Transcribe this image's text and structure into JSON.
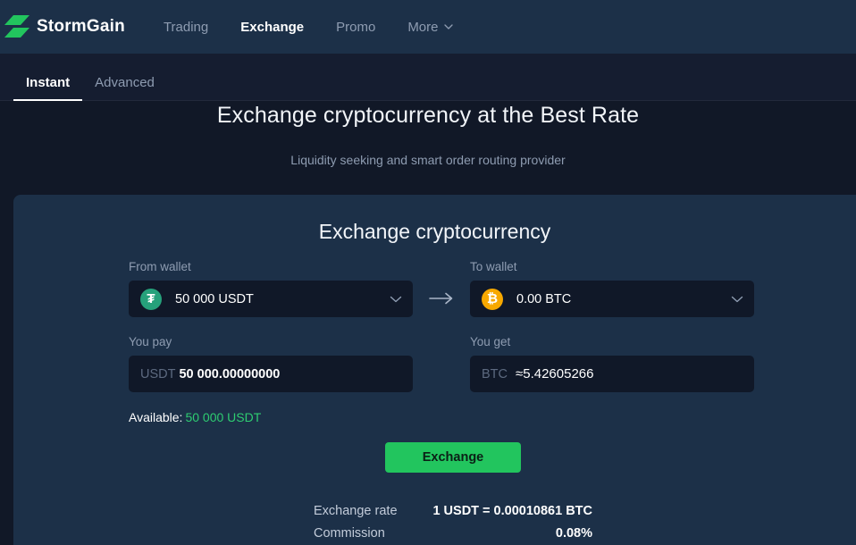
{
  "header": {
    "brand": "StormGain",
    "logo_icon": "stormgain-lightning-logo",
    "accent_green": "#22c55e",
    "nav": [
      {
        "label": "Trading",
        "active": false,
        "has_chevron": false
      },
      {
        "label": "Exchange",
        "active": true,
        "has_chevron": false
      },
      {
        "label": "Promo",
        "active": false,
        "has_chevron": false
      },
      {
        "label": "More",
        "active": false,
        "has_chevron": true
      }
    ]
  },
  "tabs": [
    {
      "label": "Instant",
      "active": true
    },
    {
      "label": "Advanced",
      "active": false
    }
  ],
  "hero": {
    "title": "Exchange cryptocurrency at the Best Rate",
    "subtitle": "Liquidity seeking and smart order routing provider"
  },
  "card": {
    "title": "Exchange cryptocurrency",
    "from": {
      "label": "From wallet",
      "coin_icon": "usdt-tether-icon",
      "coin_symbol": "₮",
      "coin_color": "#26a17b",
      "value": "50 000 USDT",
      "chevron_icon": "chevron-down-icon"
    },
    "to": {
      "label": "To wallet",
      "coin_icon": "bitcoin-icon",
      "coin_symbol": "₿",
      "coin_color": "#f7a800",
      "value": "0.00 BTC",
      "chevron_icon": "chevron-down-icon"
    },
    "arrow_icon": "arrow-right-icon",
    "you_pay": {
      "label": "You pay",
      "currency": "USDT",
      "value": "50 000.00000000"
    },
    "you_get": {
      "label": "You get",
      "currency": "BTC",
      "value": "≈5.42605266"
    },
    "available": {
      "label": "Available:",
      "amount": "50 000 USDT",
      "amount_color": "#2ecc71"
    },
    "exchange_button": "Exchange",
    "rates": [
      {
        "label": "Exchange rate",
        "value": "1 USDT = 0.00010861 BTC"
      },
      {
        "label": "Commission",
        "value": "0.08%"
      }
    ]
  }
}
